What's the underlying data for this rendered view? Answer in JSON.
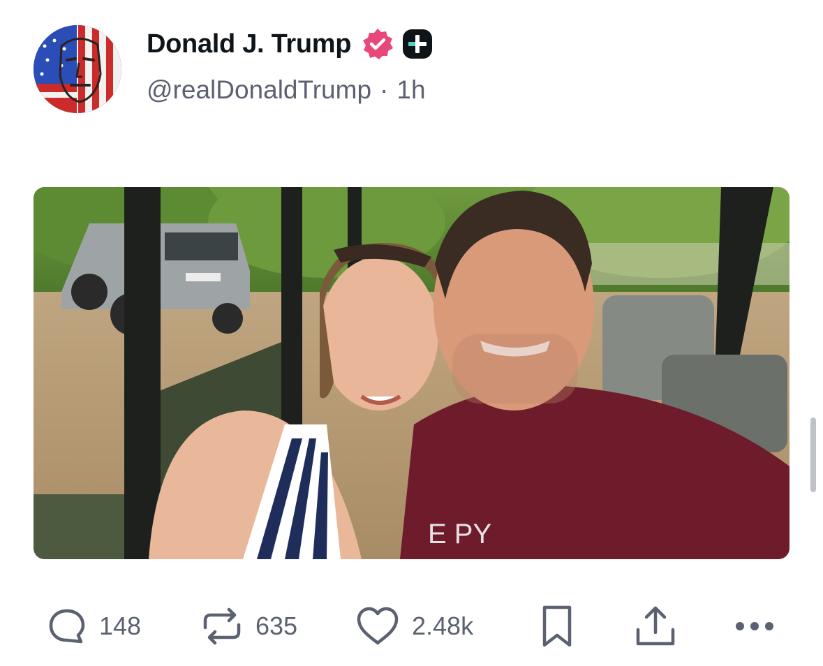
{
  "post": {
    "author": {
      "display_name": "Donald J. Trump",
      "handle": "@realDonaldTrump",
      "verified_icon": "verified-badge-icon",
      "extra_badge_icon": "plus-badge-icon",
      "avatar_icon": "flag-face-avatar"
    },
    "separator": "·",
    "time_ago": "1h",
    "media": {
      "description_icon": "selfie-photo",
      "shirt_text": "E PY"
    },
    "actions": {
      "replies": "148",
      "reposts": "635",
      "likes": "2.48k"
    }
  },
  "colors": {
    "verified": "#e8477a",
    "icon_gray": "#5b6170",
    "name": "#0f1419"
  }
}
